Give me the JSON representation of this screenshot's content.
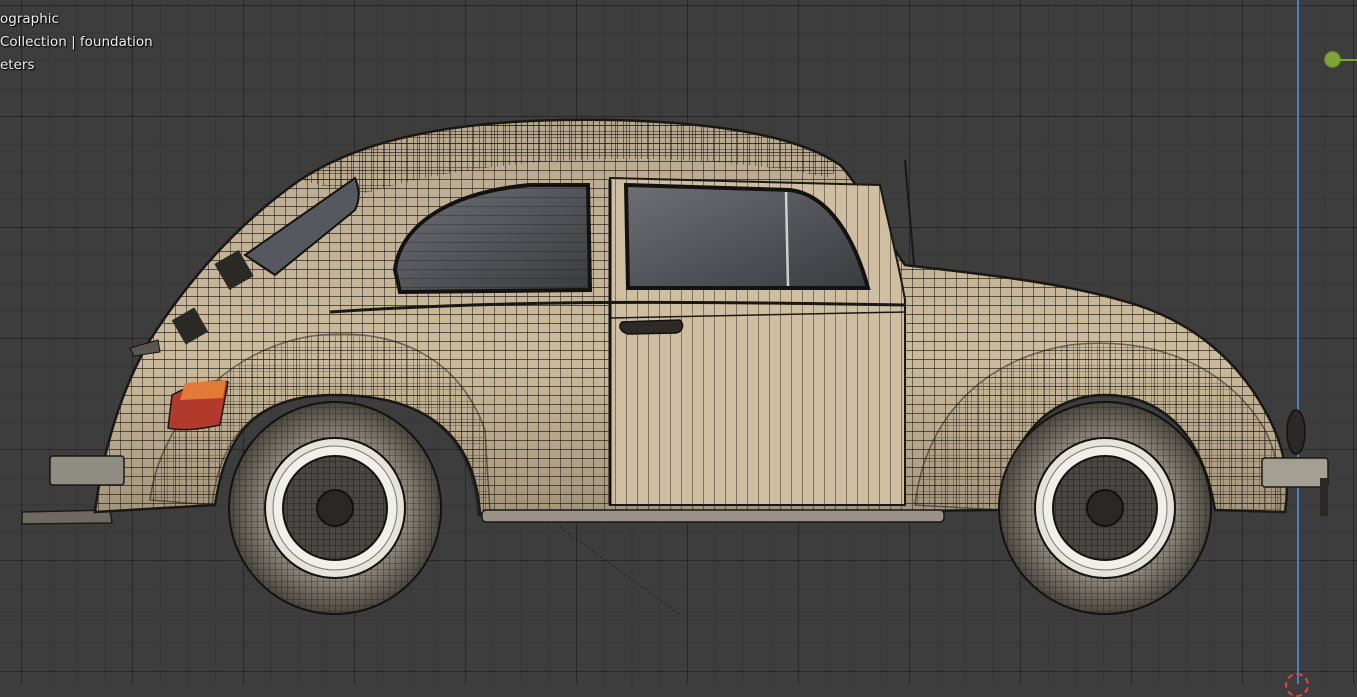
{
  "viewport": {
    "view_name": "ographic",
    "collection_label": "Collection | foundation",
    "units_label": "eters"
  },
  "scene": {
    "object": "car-side-view",
    "shading": "wireframe-over-solid",
    "body_color": "#c9b79a",
    "grid_color": "#3d3d3d",
    "z_axis_color": "#4d7fc4",
    "gizmo_color": "#7fa536",
    "cursor_color": "#e04545"
  }
}
